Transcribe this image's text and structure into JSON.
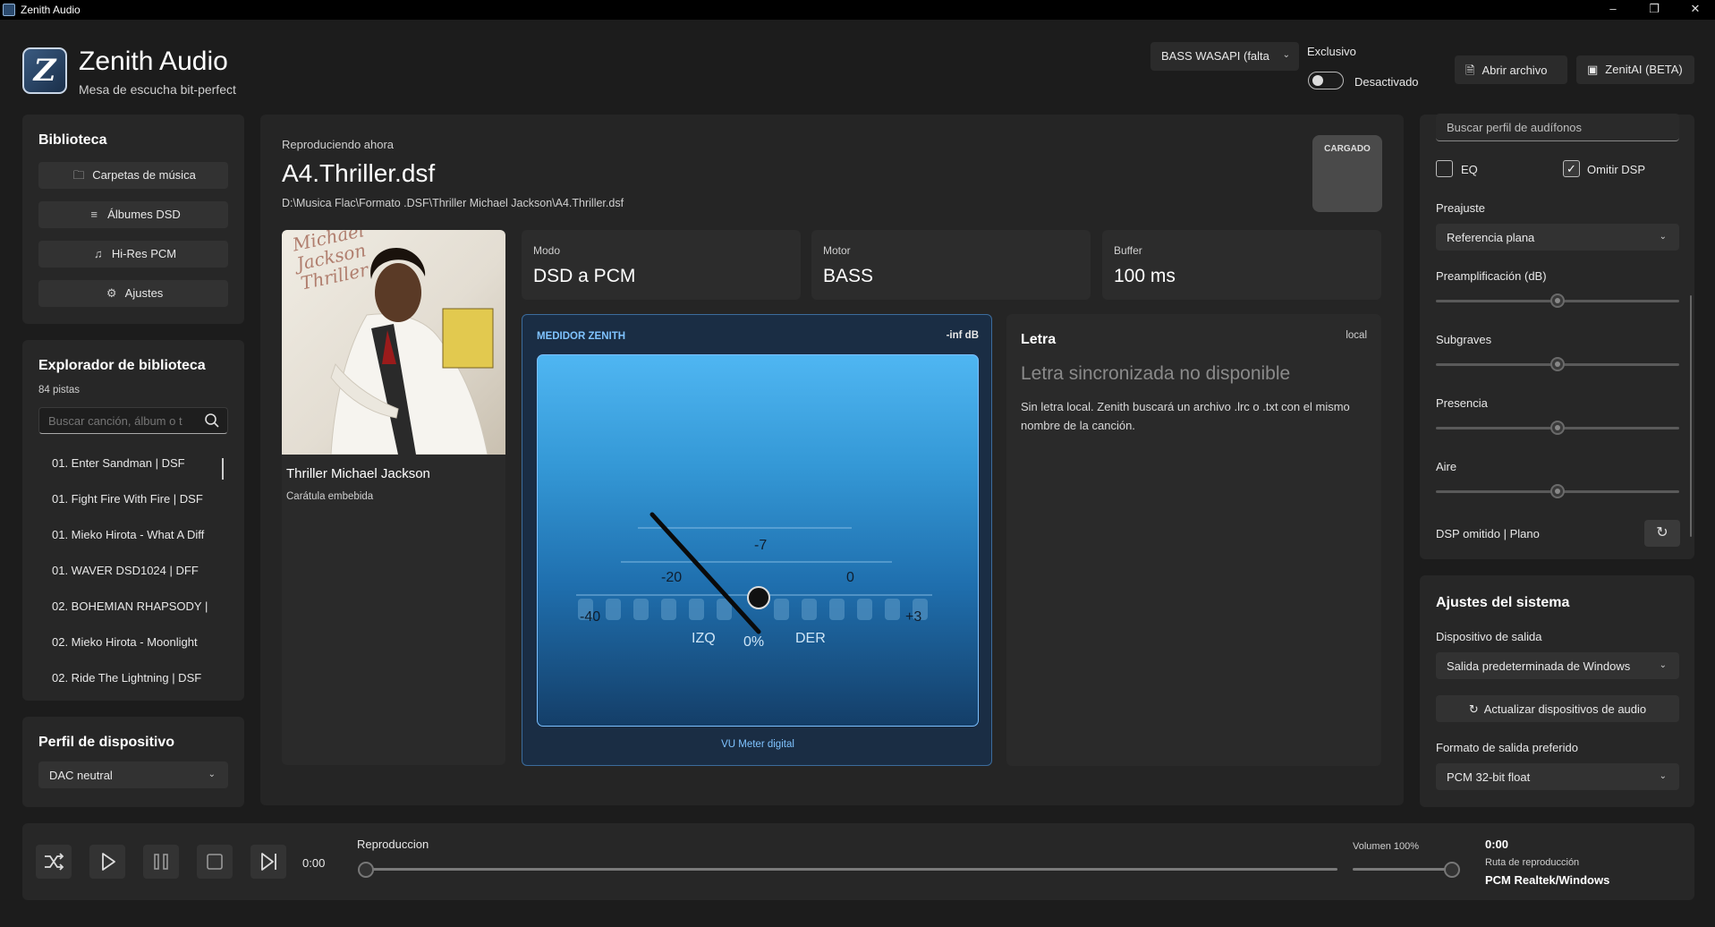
{
  "window": {
    "title": "Zenith Audio",
    "minimize": "–",
    "maximize": "❐",
    "close": "✕"
  },
  "header": {
    "logo_glyph": "Z",
    "app_name": "Zenith Audio",
    "subtitle": "Mesa de escucha bit-perfect",
    "output_engine": "BASS WASAPI (falta",
    "exclusive_label": "Exclusivo",
    "exclusive_state": "Desactivado",
    "open_file": "Abrir archivo",
    "zenitai": "ZenitAI (BETA)"
  },
  "library": {
    "title": "Biblioteca",
    "buttons": [
      "Carpetas de música",
      "Álbumes DSD",
      "Hi-Res PCM",
      "Ajustes"
    ]
  },
  "explorer": {
    "title": "Explorador de biblioteca",
    "count": "84 pistas",
    "search_placeholder": "Buscar canción, álbum o t",
    "tracks": [
      "01. Enter Sandman  |  DSF",
      "01. Fight Fire With Fire  |  DSF",
      "01. Mieko Hirota - What A Diff",
      "01. WAVER DSD1024  |  DFF",
      "02. BOHEMIAN RHAPSODY  |",
      "02. Mieko Hirota - Moonlight",
      "02. Ride The Lightning  |  DSF"
    ]
  },
  "device_profile": {
    "title": "Perfil de dispositivo",
    "value": "DAC neutral"
  },
  "now_playing": {
    "label": "Reproduciendo ahora",
    "title": "A4.Thriller.dsf",
    "path": "D:\\Musica Flac\\Formato .DSF\\Thriller Michael Jackson\\A4.Thriller.dsf",
    "badge": "CARGADO",
    "album": "Thriller Michael Jackson",
    "cover_note": "Carátula embebida",
    "cover_text": "Michael Jackson Thriller"
  },
  "stats": [
    {
      "label": "Modo",
      "value": "DSD a PCM"
    },
    {
      "label": "Motor",
      "value": "BASS"
    },
    {
      "label": "Buffer",
      "value": "100 ms"
    }
  ],
  "meter": {
    "header": "MEDIDOR ZENITH",
    "db": "-inf dB",
    "scale": {
      "m40": "-40",
      "m20": "-20",
      "m7": "-7",
      "z": "0",
      "p3": "+3"
    },
    "left": "IZQ",
    "right": "DER",
    "percent": "0%",
    "footer": "VU Meter digital"
  },
  "lyrics": {
    "title": "Letra",
    "source": "local",
    "heading": "Letra sincronizada no disponible",
    "body": "Sin letra local. Zenith buscará un archivo .lrc o .txt con el mismo nombre de la canción."
  },
  "eq": {
    "search_placeholder": "Buscar perfil de audífonos",
    "eq_label": "EQ",
    "eq_checked": false,
    "skip_dsp_label": "Omitir DSP",
    "skip_dsp_checked": true,
    "preset_label": "Preajuste",
    "preset_value": "Referencia plana",
    "sliders": [
      {
        "label": "Preamplificación (dB)",
        "value": 0.5
      },
      {
        "label": "Subgraves",
        "value": 0.5
      },
      {
        "label": "Presencia",
        "value": 0.5
      },
      {
        "label": "Aire",
        "value": 0.5
      }
    ],
    "status": "DSP omitido | Plano"
  },
  "system": {
    "title": "Ajustes del sistema",
    "output_label": "Dispositivo de salida",
    "output_value": "Salida predeterminada de Windows",
    "refresh": "Actualizar dispositivos de audio",
    "format_label": "Formato de salida preferido",
    "format_value": "PCM 32-bit float"
  },
  "player": {
    "time": "0:00",
    "label": "Reproduccion",
    "progress": 0,
    "volume_label": "Volumen 100%",
    "volume": 1.0,
    "right_time": "0:00",
    "route_label": "Ruta de reproducción",
    "route_value": "PCM Realtek/Windows"
  },
  "colors": {
    "accent": "#7fc3ff",
    "meter_border": "#3c6c9c"
  }
}
